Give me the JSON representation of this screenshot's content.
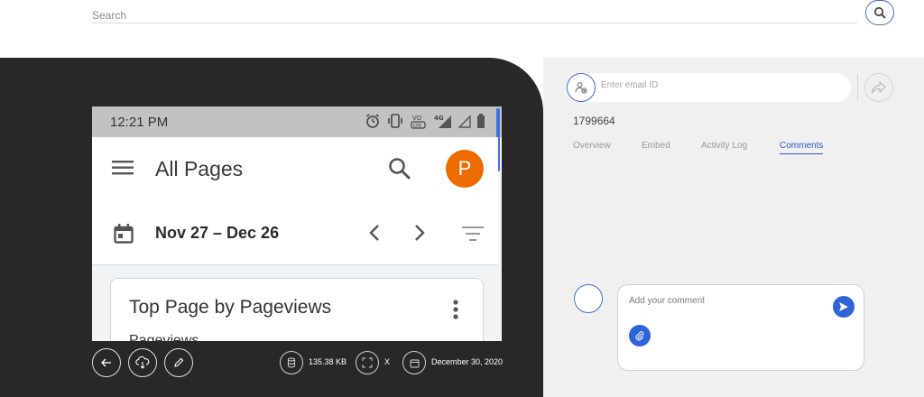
{
  "search": {
    "placeholder": "Search"
  },
  "phone": {
    "status_time": "12:21 PM",
    "app_title": "All Pages",
    "avatar_letter": "P",
    "date_range": "Nov 27 – Dec 26",
    "card_title": "Top Page by Pageviews",
    "card_subtitle": "Pageviews"
  },
  "toolbar": {
    "file_size": "135.38 KB",
    "dimensions": "X",
    "date": "December 30, 2020"
  },
  "share": {
    "email_placeholder": "Enter email ID"
  },
  "doc": {
    "id": "1799664"
  },
  "tabs": [
    {
      "label": "Overview"
    },
    {
      "label": "Embed"
    },
    {
      "label": "Activity Log"
    },
    {
      "label": "Comments",
      "active": true
    }
  ],
  "comment": {
    "placeholder": "Add your comment"
  },
  "colors": {
    "accent": "#2f63d8",
    "viewer_bg": "#282828",
    "avatar_orange": "#ee6b00"
  },
  "icons": {
    "search": "search-icon",
    "back": "arrow-left-icon",
    "download": "cloud-download-icon",
    "edit": "pencil-icon",
    "share": "share-arrow-icon",
    "send": "send-icon",
    "attach": "paperclip-icon"
  }
}
